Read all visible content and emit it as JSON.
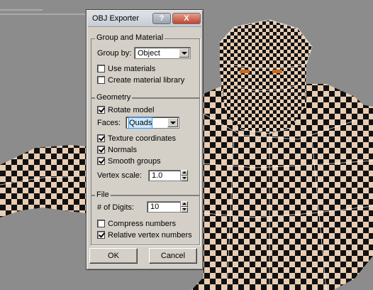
{
  "dialog": {
    "title": "OBJ Exporter",
    "help": "?",
    "close": "X"
  },
  "group_material": {
    "label": "Group and Material",
    "group_by_label": "Group by:",
    "group_by_value": "Object",
    "use_materials": {
      "label": "Use materials",
      "checked": false
    },
    "create_library": {
      "label": "Create material library",
      "checked": false
    }
  },
  "geometry": {
    "label": "Geometry",
    "rotate_model": {
      "label": "Rotate model",
      "checked": true
    },
    "faces_label": "Faces:",
    "faces_value": "Quads",
    "texture_coordinates": {
      "label": "Texture coordinates",
      "checked": true
    },
    "normals": {
      "label": "Normals",
      "checked": true
    },
    "smooth_groups": {
      "label": "Smooth groups",
      "checked": true
    },
    "vertex_scale_label": "Vertex scale:",
    "vertex_scale_value": "1.0"
  },
  "file": {
    "label": "File",
    "digits_label": "# of Digits:",
    "digits_value": "10",
    "compress_numbers": {
      "label": "Compress numbers",
      "checked": false
    },
    "relative_vertex": {
      "label": "Relative vertex numbers",
      "checked": true
    }
  },
  "buttons": {
    "ok": "OK",
    "cancel": "Cancel"
  },
  "colors": {
    "viewport_bg": "#8c8c8c",
    "checker_light": "#e8cdb4",
    "checker_dark": "#111111",
    "dialog_bg": "#d4d0c8"
  }
}
